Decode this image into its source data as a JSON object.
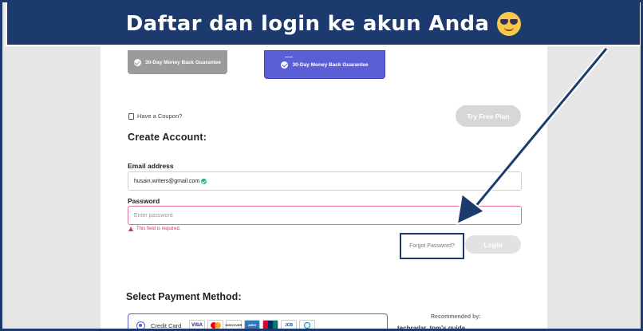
{
  "banner": {
    "title": "Daftar dan login ke akun Anda",
    "emoji": "sunglasses-face-icon"
  },
  "plans": {
    "gray_guarantee": "30-Day Money Back Guarantee",
    "blue_guarantee": "30-Day Money Back Guarantee"
  },
  "coupon": {
    "label": "Have a Coupon?"
  },
  "try_free": {
    "label": "Try Free Plan"
  },
  "create_account": {
    "title": "Create Account:",
    "email_label": "Email address",
    "email_value": "husain.writers@gmail.com",
    "password_label": "Password",
    "password_placeholder": "Enter password",
    "error_text": "This field is required.",
    "forgot_label": "Forgot Password?",
    "login_label": "Login"
  },
  "payment": {
    "title": "Select Payment Method:",
    "option_label": "Credit Card",
    "cards": [
      "VISA",
      "mastercard",
      "DISCOVER",
      "AMEX",
      "UnionPay",
      "JCB",
      "Diners"
    ]
  },
  "recommended": {
    "label": "Recommended by:",
    "press": "techradar.  tom's guide"
  },
  "colors": {
    "brand_navy": "#1d3a6e",
    "accent_purple": "#5b5fd6",
    "error": "#d23a5a"
  }
}
